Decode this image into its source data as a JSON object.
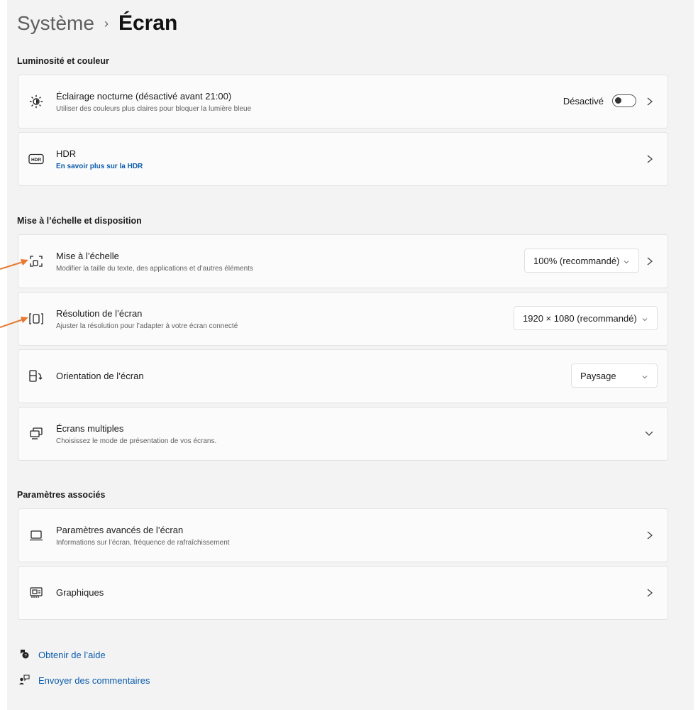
{
  "breadcrumb": {
    "parent": "Système",
    "separator": "›",
    "current": "Écran"
  },
  "sections": {
    "brightness": "Luminosité et couleur",
    "scaling": "Mise à l’échelle et disposition",
    "related": "Paramètres associés"
  },
  "cards": {
    "night_light": {
      "icon": "brightness-icon",
      "title": "Éclairage nocturne (désactivé avant 21:00)",
      "subtitle": "Utiliser des couleurs plus claires pour bloquer la lumière bleue",
      "toggle_label": "Désactivé",
      "toggle_on": false
    },
    "hdr": {
      "icon": "hdr-icon",
      "title": "HDR",
      "link": "En savoir plus sur la HDR"
    },
    "scale": {
      "icon": "scale-icon",
      "title": "Mise à l’échelle",
      "subtitle": "Modifier la taille du texte, des applications et d’autres éléments",
      "value": "100% (recommandé)"
    },
    "resolution": {
      "icon": "resolution-icon",
      "title": "Résolution de l’écran",
      "subtitle": "Ajuster la résolution pour l’adapter à  votre  écran connecté",
      "value": "1920 × 1080 (recommandé)"
    },
    "orientation": {
      "icon": "orientation-icon",
      "title": "Orientation de l’écran",
      "value": "Paysage"
    },
    "multi": {
      "icon": "multiple-displays-icon",
      "title": "Écrans multiples",
      "subtitle": "Choisissez le mode de présentation de vos écrans."
    },
    "advanced": {
      "icon": "laptop-icon",
      "title": "Paramètres avancés de l’écran",
      "subtitle": "Informations sur l’écran, fréquence de rafraîchissement"
    },
    "graphics": {
      "icon": "graphics-card-icon",
      "title": "Graphiques"
    }
  },
  "footer": {
    "help": "Obtenir de l’aide",
    "feedback": "Envoyer des commentaires"
  },
  "colors": {
    "accent": "#0b5cad",
    "annotation_arrow": "#e8792f"
  }
}
